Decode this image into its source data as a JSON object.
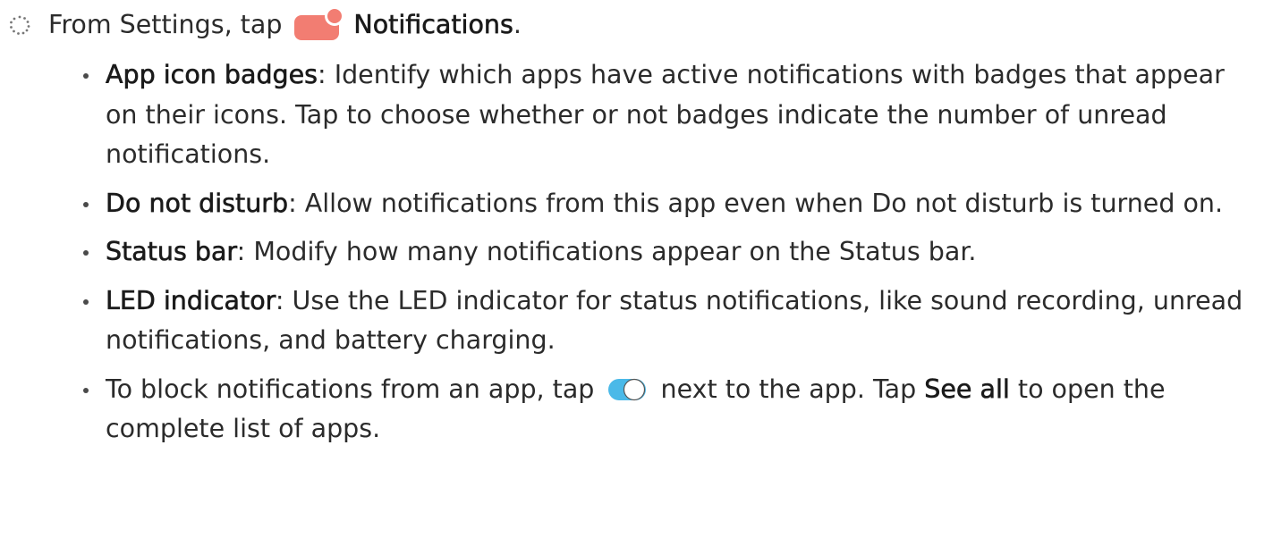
{
  "step": {
    "prefix": "From Settings, tap",
    "target": "Notifications",
    "suffix": "."
  },
  "bullets": [
    {
      "term": "App icon badges",
      "separator": ": ",
      "text": "Identify which apps have active notifications with badges that appear on their icons. Tap to choose whether or not badges indicate the number of unread notifications."
    },
    {
      "term": "Do not disturb",
      "separator": ": ",
      "text": "Allow notifications from this app even when Do not disturb is turned on."
    },
    {
      "term": "Status bar",
      "separator": ": ",
      "text": "Modify how many notifications appear on the Status bar."
    },
    {
      "term": "LED indicator",
      "separator": ": ",
      "text": "Use the LED indicator for status notifications, like sound recording, unread notifications, and battery charging."
    }
  ],
  "last_bullet": {
    "text_before": "To block notifications from an app, tap",
    "text_middle": "next to the app. Tap",
    "link": "See all",
    "text_after": "to open the complete list of apps."
  },
  "icons": {
    "step_marker": "dotted-circle-icon",
    "notifications": "notifications-settings-icon",
    "toggle": "toggle-switch-icon"
  },
  "colors": {
    "notifications_icon": "#f27d72",
    "toggle_on": "#4ab9e8"
  }
}
